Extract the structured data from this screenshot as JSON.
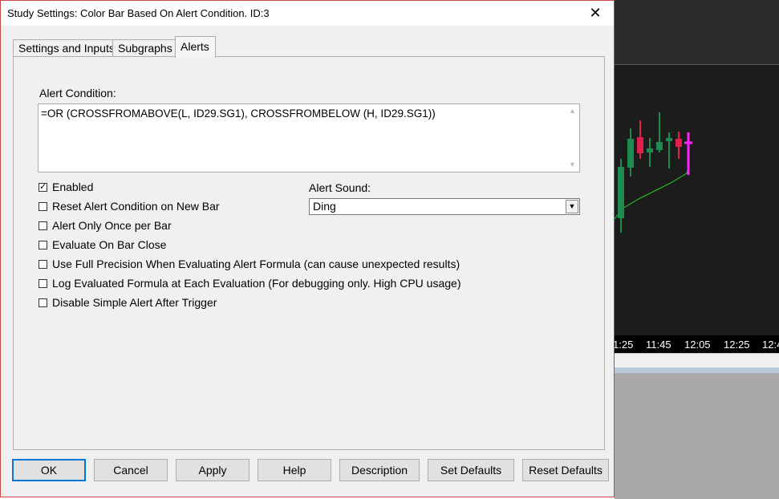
{
  "dialog": {
    "title": "Study Settings: Color Bar Based On Alert Condition. ID:3",
    "close_glyph": "✕"
  },
  "tabs": [
    {
      "label": "Settings and Inputs",
      "active": false
    },
    {
      "label": "Subgraphs",
      "active": false
    },
    {
      "label": "Alerts",
      "active": true
    }
  ],
  "alerts": {
    "condition_label": "Alert Condition:",
    "condition_value": "=OR (CROSSFROMABOVE(L, ID29.SG1), CROSSFROMBELOW (H, ID29.SG1))",
    "checkboxes": [
      {
        "label": "Enabled",
        "checked": true
      },
      {
        "label": "Reset Alert Condition on New Bar",
        "checked": false
      },
      {
        "label": "Alert Only Once per Bar",
        "checked": false
      },
      {
        "label": "Evaluate On Bar Close",
        "checked": false
      },
      {
        "label": "Use Full Precision When Evaluating Alert Formula (can cause unexpected results)",
        "checked": false
      },
      {
        "label": "Log Evaluated Formula at Each Evaluation (For debugging only. High CPU usage)",
        "checked": false
      },
      {
        "label": "Disable Simple Alert After Trigger",
        "checked": false
      }
    ],
    "sound_label": "Alert Sound:",
    "sound_value": "Ding"
  },
  "buttons": {
    "ok": "OK",
    "cancel": "Cancel",
    "apply": "Apply",
    "help": "Help",
    "description": "Description",
    "set_defaults": "Set Defaults",
    "reset_defaults": "Reset Defaults"
  },
  "chart": {
    "time_labels": [
      "1:25",
      "11:45",
      "12:05",
      "12:25",
      "12:4"
    ],
    "colors": {
      "up": "#1e8c4e",
      "down": "#e0204a",
      "highlight": "#ff22ff",
      "line": "#22cc22"
    }
  }
}
